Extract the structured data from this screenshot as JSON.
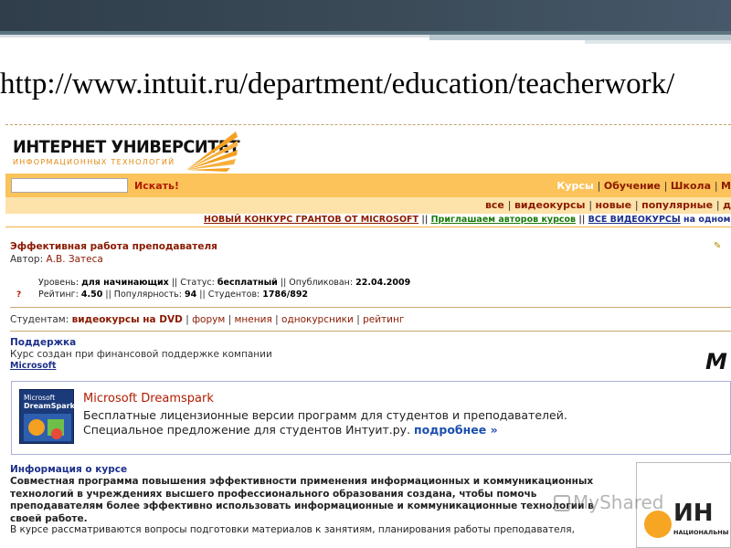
{
  "page_url": "http://www.intuit.ru/department/education/teacherwork/",
  "logo": {
    "title": "ИНТЕРНЕТ УНИВЕРСИТЕТ",
    "subtitle": "ИНФОРМАЦИОННЫХ ТЕХНОЛОГИЙ"
  },
  "search": {
    "value": "",
    "button": "Искать!"
  },
  "nav_primary": [
    "Курсы",
    "Обучение",
    "Школа",
    "М"
  ],
  "nav_secondary": [
    "все",
    "видеокурсы",
    "новые",
    "популярные",
    "д"
  ],
  "announcements": {
    "grants": "НОВЫЙ КОНКУРС ГРАНТОВ ОТ MICROSOFT",
    "authors": "Приглашаем авторов курсов",
    "video": "ВСЕ ВИДЕОКУРСЫ",
    "video_tail": "на одном"
  },
  "course": {
    "title": "Эффективная работа преподавателя",
    "author_label": "Автор:",
    "author_name": "А.В. Затеса",
    "level_label": "Уровень:",
    "level": "для начинающих",
    "status_label": "Статус:",
    "status": "бесплатный",
    "published_label": "Опубликован:",
    "published": "22.04.2009",
    "rating_label": "Рейтинг:",
    "rating": "4.50",
    "popularity_label": "Популярность:",
    "popularity": "94",
    "students_label": "Студентов:",
    "students": "1786/892"
  },
  "students_links": {
    "label": "Студентам:",
    "dvd": "видеокурсы на DVD",
    "items": [
      "форум",
      "мнения",
      "однокурсники",
      "рейтинг"
    ]
  },
  "support": {
    "heading": "Поддержка",
    "text": "Курс создан при финансовой поддержке компании",
    "link": "Microsoft",
    "logo_text": "M"
  },
  "dreamspark": {
    "logo_line1": "Microsoft",
    "logo_line2": "DreamSpark",
    "title": "Microsoft Dreamspark",
    "line1": "Бесплатные лицензионные версии программ для студентов и преподавателей.",
    "line2": "Специальное предложение для студентов Интуит.ру.",
    "more": "подробнее »"
  },
  "info": {
    "heading": "Информация о курсе",
    "paragraph": "Совместная программа повышения эффективности применения информационных и коммуникационных технологий в учреждениях высшего профессионального образования создана, чтобы помочь преподавателям более эффективно использовать информационные и коммуникационные технологии в своей работе.",
    "paragraph2": "В курсе рассматриваются вопросы подготовки материалов к занятиям, планирования работы преподавателя,"
  },
  "right_panel": {
    "text": "ИН",
    "sub": "НАЦИОНАЛЬНЫ"
  },
  "watermark": "MyShared",
  "colors": {
    "orange_bar": "#fbc35a",
    "brand_red": "#8a1a00",
    "link_blue": "#1c2f8a"
  }
}
